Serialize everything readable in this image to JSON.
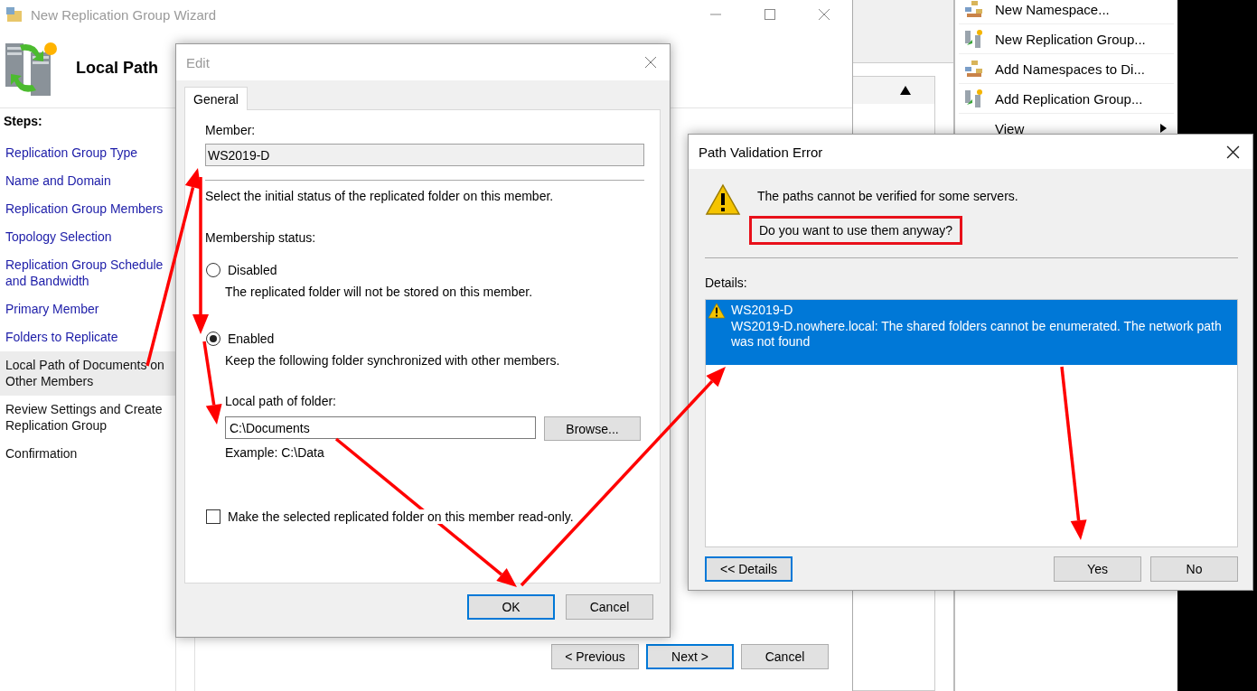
{
  "wizard": {
    "title": "New Replication Group Wizard",
    "heading": "Local Path",
    "steps_label": "Steps:",
    "steps": [
      {
        "label": "Replication Group Type",
        "completed": true,
        "selected": false
      },
      {
        "label": "Name and Domain",
        "completed": true,
        "selected": false
      },
      {
        "label": "Replication Group Members",
        "completed": true,
        "selected": false
      },
      {
        "label": "Topology Selection",
        "completed": true,
        "selected": false
      },
      {
        "label": "Replication Group Schedule and Bandwidth",
        "completed": true,
        "selected": false
      },
      {
        "label": "Primary Member",
        "completed": true,
        "selected": false
      },
      {
        "label": "Folders to Replicate",
        "completed": true,
        "selected": false
      },
      {
        "label": "Local Path of Documents on Other Members",
        "completed": false,
        "selected": true
      },
      {
        "label": "Review Settings and Create Replication Group",
        "completed": false,
        "selected": false
      },
      {
        "label": "Confirmation",
        "completed": false,
        "selected": false
      }
    ],
    "buttons": [
      {
        "label": "< Previous",
        "focused": false
      },
      {
        "label": "Next >",
        "focused": true
      },
      {
        "label": "Cancel",
        "focused": false
      }
    ]
  },
  "actions_pane": {
    "items": [
      {
        "label": "New Namespace...",
        "kind": "namespace",
        "submenu": false
      },
      {
        "label": "New Replication Group...",
        "kind": "replication",
        "submenu": false
      },
      {
        "label": "Add Namespaces to Di...",
        "kind": "namespace",
        "submenu": false
      },
      {
        "label": "Add Replication Group...",
        "kind": "replication",
        "submenu": false
      },
      {
        "label": "View",
        "kind": "plain",
        "submenu": true
      }
    ]
  },
  "edit_dialog": {
    "title": "Edit",
    "tabs": [
      {
        "label": "General",
        "selected": true
      }
    ],
    "member_label": "Member:",
    "member_value": "WS2019-D",
    "instruction": "Select the initial status of the replicated folder on this member.",
    "membership_label": "Membership status:",
    "options": [
      {
        "label": "Disabled",
        "description": "The replicated folder will not be stored on this member.",
        "selected": false
      },
      {
        "label": "Enabled",
        "description": "Keep the following folder synchronized with other members.",
        "selected": true
      }
    ],
    "path_label": "Local path of folder:",
    "path_value": "C:\\Documents",
    "browse": "Browse...",
    "example": "Example: C:\\Data",
    "readonly": {
      "label": "Make the selected replicated folder on this member read-only.",
      "checked": false
    },
    "buttons": [
      {
        "label": "OK",
        "focused": true
      },
      {
        "label": "Cancel",
        "focused": false
      }
    ]
  },
  "error_dialog": {
    "title": "Path Validation Error",
    "message": "The paths cannot be verified for some servers.",
    "question": "Do you want to use them anyway?",
    "details_label": "Details:",
    "details": [
      {
        "name": "WS2019-D",
        "text": "WS2019-D.nowhere.local: The shared folders cannot be enumerated. The network path was not found",
        "selected": true
      }
    ],
    "buttons": [
      {
        "label": "<< Details",
        "focused": true
      },
      {
        "label": "Yes",
        "focused": false
      },
      {
        "label": "No",
        "focused": false
      }
    ]
  }
}
